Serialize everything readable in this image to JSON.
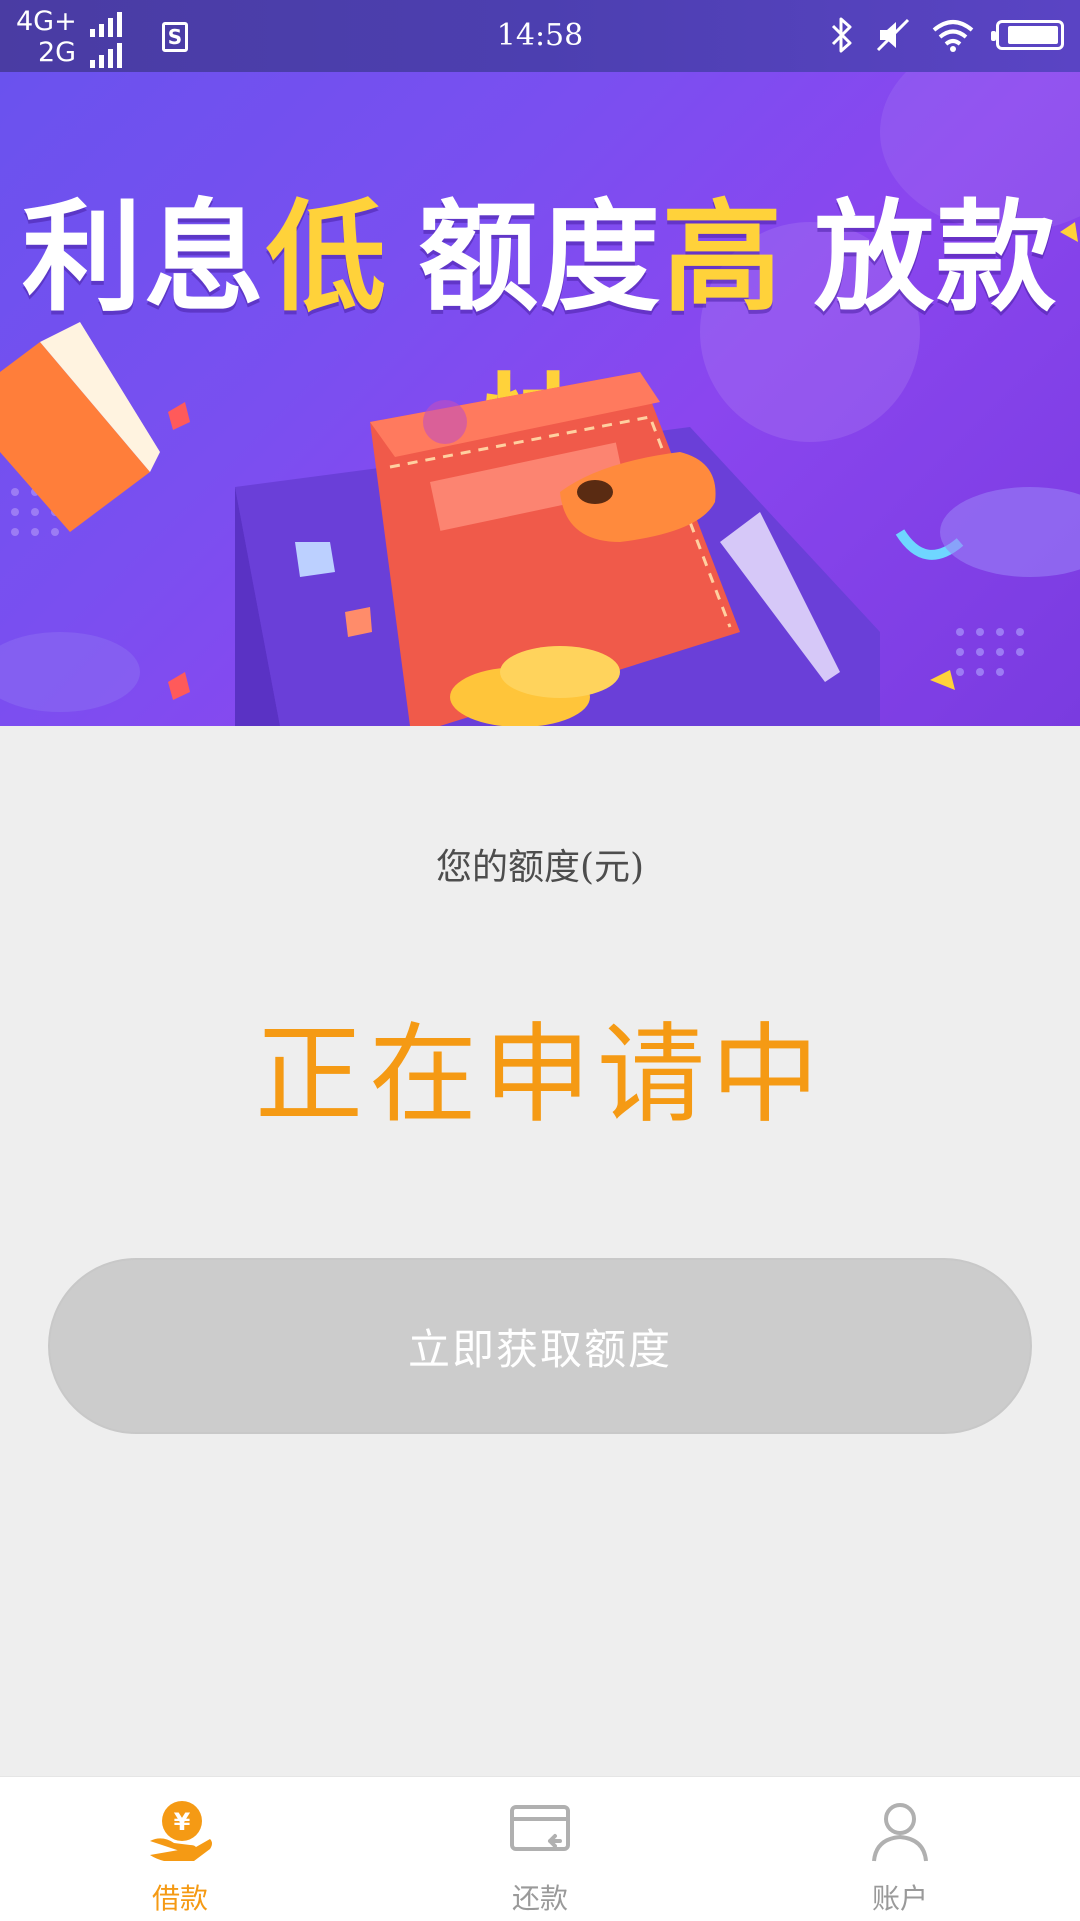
{
  "status_bar": {
    "network_1": "4G+",
    "network_2": "2G",
    "sim_badge": "S",
    "time": "14:58",
    "icons": [
      "bluetooth-icon",
      "silent-icon",
      "wifi-icon",
      "battery-icon"
    ]
  },
  "banner": {
    "headline_parts": [
      {
        "text": "利息",
        "color": "#ffffff"
      },
      {
        "text": "低",
        "color": "#ffd23a"
      },
      {
        "text": "额度",
        "color": "#ffffff"
      },
      {
        "text": "高",
        "color": "#ffd23a"
      },
      {
        "text": "放款",
        "color": "#ffffff"
      },
      {
        "text": "快",
        "color": "#ffd23a"
      }
    ]
  },
  "main": {
    "credit_label": "您的额度(元)",
    "status": "正在申请中",
    "cta_label": "立即获取额度"
  },
  "tabbar": {
    "items": [
      {
        "label": "借款",
        "icon": "loan-hand-coin-icon",
        "active": true
      },
      {
        "label": "还款",
        "icon": "repay-card-icon",
        "active": false
      },
      {
        "label": "账户",
        "icon": "account-person-icon",
        "active": false
      }
    ]
  },
  "colors": {
    "accent": "#f59a14",
    "button_disabled": "#cccccc",
    "background": "#eeeeee",
    "highlight": "#ffd23a"
  }
}
